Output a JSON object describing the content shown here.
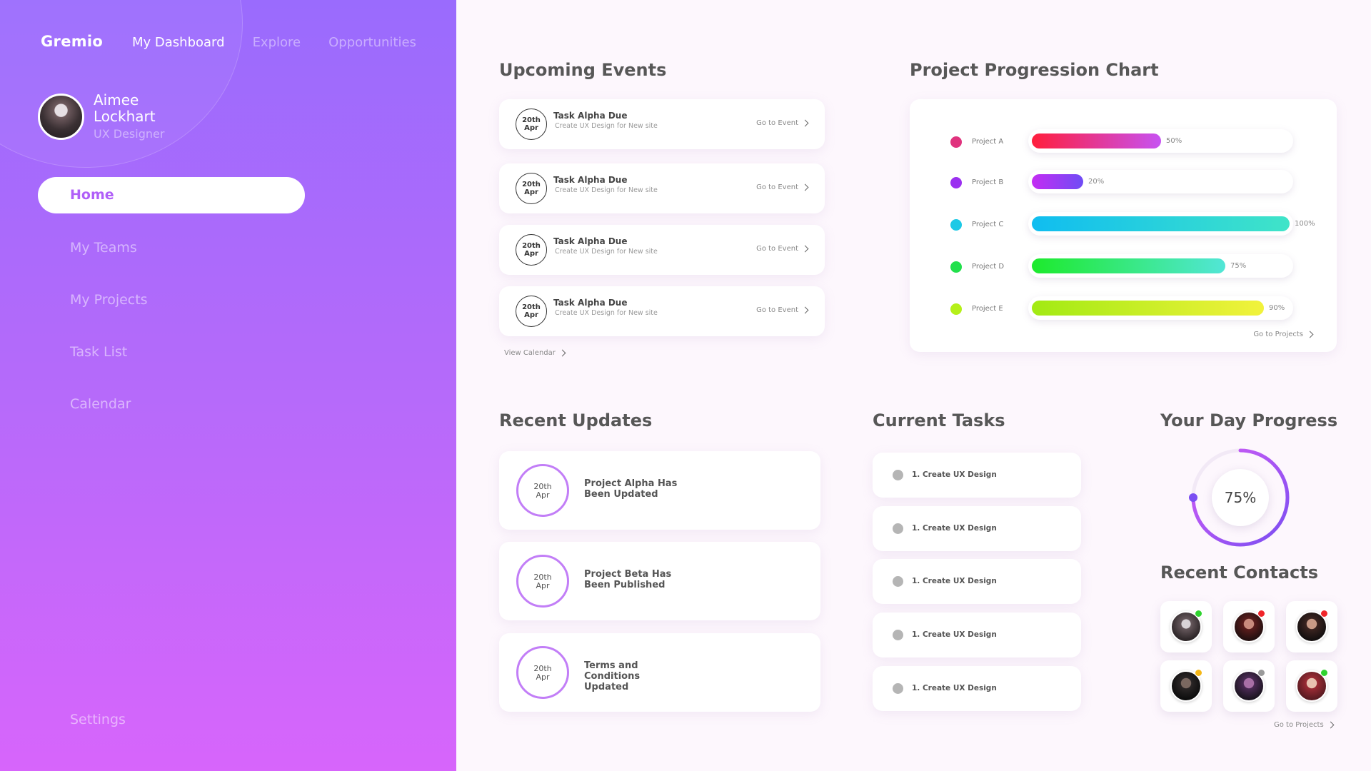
{
  "brand": "Gremio",
  "top_nav": [
    "My Dashboard",
    "Explore",
    "Opportunities"
  ],
  "profile": {
    "name": "Aimee Lockhart",
    "role": "UX Designer"
  },
  "menu": {
    "home": "Home",
    "items": [
      "My Teams",
      "My Projects",
      "Task List",
      "Calendar"
    ],
    "settings": "Settings"
  },
  "upcoming_events": {
    "title": "Upcoming Events",
    "items": [
      {
        "day": "20th",
        "month": "Apr",
        "title": "Task Alpha Due",
        "subtitle": "Create UX Design for New site",
        "link": "Go to Event"
      },
      {
        "day": "20th",
        "month": "Apr",
        "title": "Task Alpha Due",
        "subtitle": "Create UX Design for New site",
        "link": "Go to Event"
      },
      {
        "day": "20th",
        "month": "Apr",
        "title": "Task Alpha Due",
        "subtitle": "Create UX Design for New site",
        "link": "Go to Event"
      },
      {
        "day": "20th",
        "month": "Apr",
        "title": "Task Alpha Due",
        "subtitle": "Create UX Design for New site",
        "link": "Go to Event"
      }
    ],
    "view_calendar": "View Calendar"
  },
  "progression": {
    "title": "Project Progression Chart",
    "link": "Go to Projects",
    "projects": [
      {
        "name": "Project A",
        "percent": 50,
        "label": "50%",
        "dot": "#e0337e",
        "from": "#ff1e3c",
        "to": "#c752f2"
      },
      {
        "name": "Project B",
        "percent": 20,
        "label": "20%",
        "dot": "#9b30f0",
        "from": "#c42cf3",
        "to": "#6f4cf5"
      },
      {
        "name": "Project C",
        "percent": 100,
        "label": "100%",
        "dot": "#1cc9e6",
        "from": "#10bdf0",
        "to": "#40e4c8"
      },
      {
        "name": "Project D",
        "percent": 75,
        "label": "75%",
        "dot": "#22e04c",
        "from": "#1dea2c",
        "to": "#52e6d7"
      },
      {
        "name": "Project E",
        "percent": 90,
        "label": "90%",
        "dot": "#b5f019",
        "from": "#a2ea13",
        "to": "#f2f23c"
      }
    ]
  },
  "recent_updates": {
    "title": "Recent Updates",
    "items": [
      {
        "day": "20th",
        "month": "Apr",
        "text": "Project Alpha Has Been Updated"
      },
      {
        "day": "20th",
        "month": "Apr",
        "text": "Project Beta Has Been Published"
      },
      {
        "day": "20th",
        "month": "Apr",
        "text": "Terms and Conditions Updated"
      }
    ]
  },
  "current_tasks": {
    "title": "Current Tasks",
    "items": [
      "1. Create UX Design",
      "1. Create UX Design",
      "1. Create UX Design",
      "1. Create UX Design",
      "1. Create UX Design"
    ]
  },
  "day_progress": {
    "title": "Your Day Progress",
    "percent": 75,
    "label": "75%",
    "accent": "#8a4cf2"
  },
  "recent_contacts": {
    "title": "Recent Contacts",
    "link": "Go to Projects",
    "contacts": [
      {
        "status": "online",
        "status_color": "#2fd32f"
      },
      {
        "status": "busy",
        "status_color": "#f0252a"
      },
      {
        "status": "busy",
        "status_color": "#f0252a"
      },
      {
        "status": "away",
        "status_color": "#f5b716"
      },
      {
        "status": "offline",
        "status_color": "#9a9a9a"
      },
      {
        "status": "online",
        "status_color": "#2fd32f"
      }
    ]
  }
}
